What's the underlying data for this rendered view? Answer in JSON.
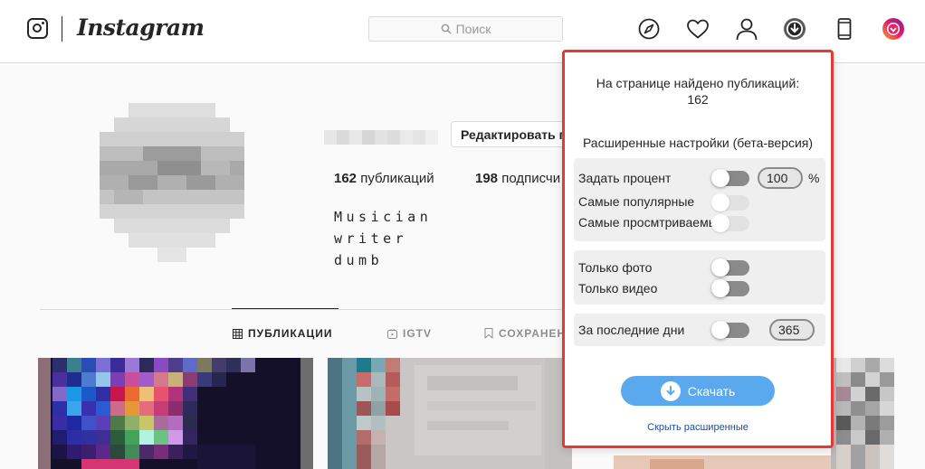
{
  "header": {
    "wordmark": "Instagram",
    "search_placeholder": "Поиск",
    "icons": [
      "explore-compass-icon",
      "heart-icon",
      "profile-icon",
      "downloader-extension-icon",
      "mobile-phone-icon",
      "extension-avatar-icon"
    ]
  },
  "profile": {
    "edit_button": "Редактировать п",
    "posts_count": "162",
    "posts_label": "публикаций",
    "followers_count": "198",
    "followers_label": "подписчи",
    "bio_lines": [
      "Musician",
      "writer",
      "dumb"
    ]
  },
  "tabs": [
    {
      "label": "ПУБЛИКАЦИИ",
      "icon": "grid-icon",
      "active": true
    },
    {
      "label": "IGTV",
      "icon": "igtv-icon",
      "active": false
    },
    {
      "label": "СОХРАНЕН",
      "icon": "bookmark-icon",
      "active": false
    }
  ],
  "popup": {
    "found_label": "На странице найдено публикаций:",
    "found_count": "162",
    "advanced_title": "Расширенные настройки (бета-версия)",
    "percent_label": "Задать процент",
    "percent_value": "100",
    "percent_sign": "%",
    "most_popular_label": "Самые популярные",
    "most_viewed_label": "Самые просмтриваемь",
    "only_photo_label": "Только фото",
    "only_video_label": "Только видео",
    "last_days_label": "За последние дни",
    "last_days_value": "365",
    "download_label": "Скачать",
    "hide_label": "Скрыть расширенные"
  },
  "colors": {
    "popup_border": "#e53935",
    "download_button": "#5aa8ee",
    "link": "#1a4fa0"
  }
}
